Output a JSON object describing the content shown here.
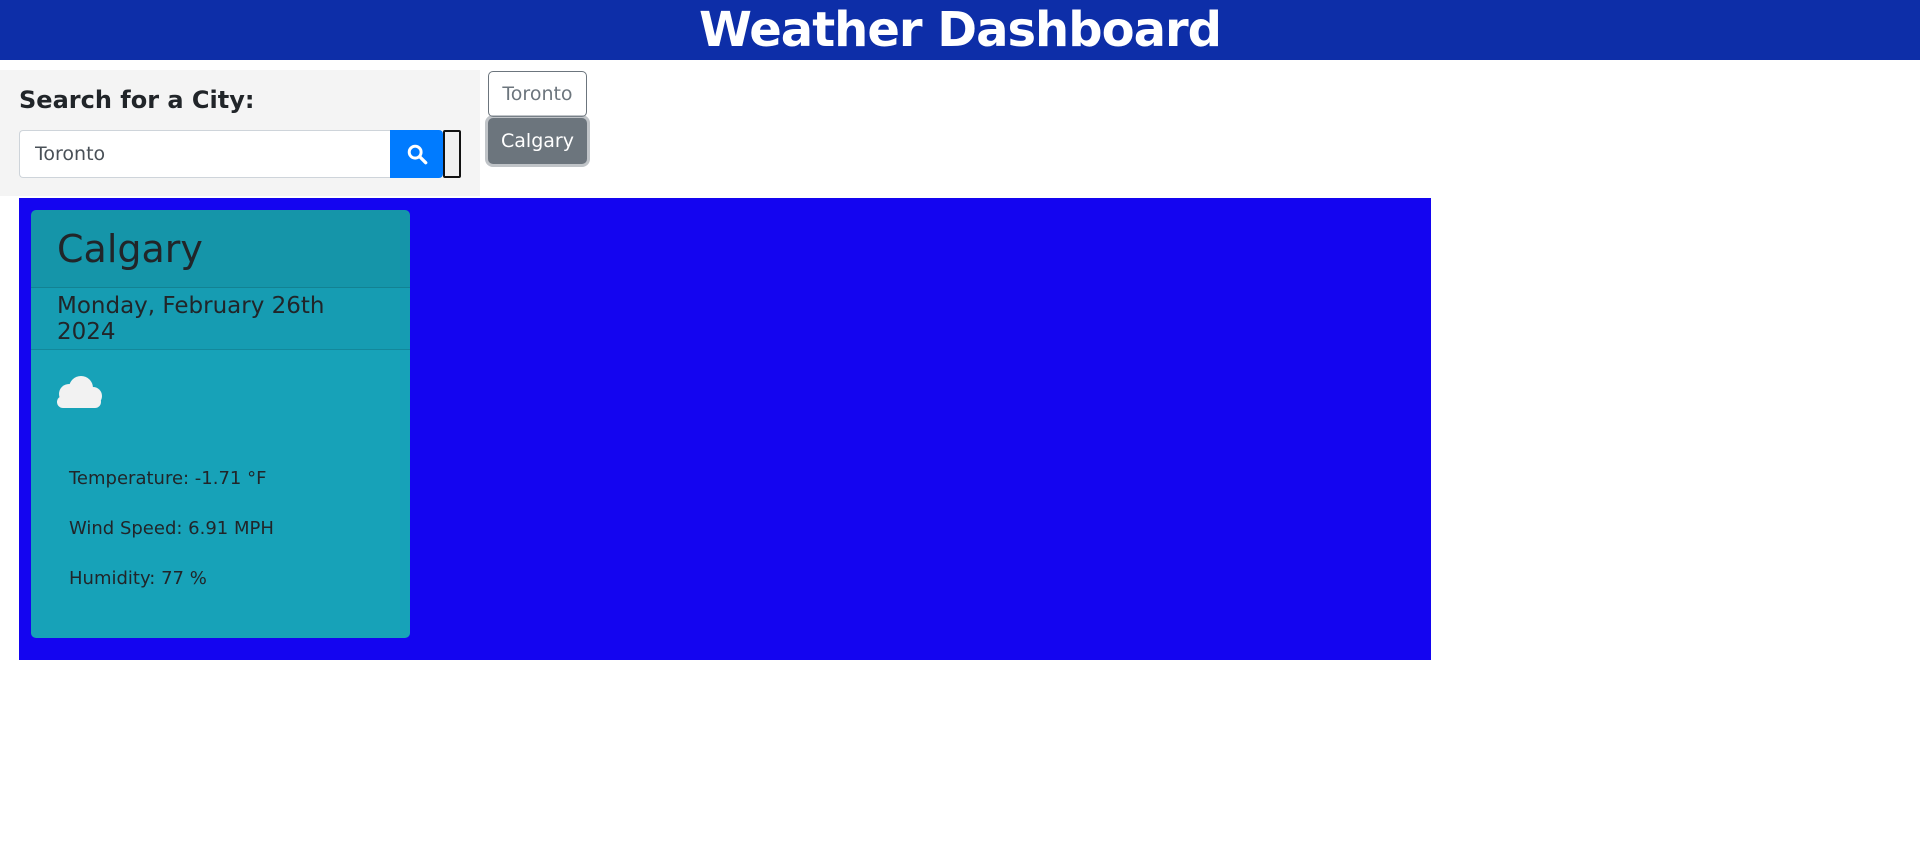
{
  "header": {
    "title": "Weather Dashboard"
  },
  "search": {
    "heading": "Search for a City:",
    "input_value": "Toronto",
    "button_icon": "search-icon"
  },
  "history": [
    {
      "label": "Toronto",
      "active": false
    },
    {
      "label": "Calgary",
      "active": true
    }
  ],
  "weather": {
    "city": "Calgary",
    "date": "Monday, February 26th 2024",
    "icon": "cloud-icon",
    "temperature": "Temperature: -1.71 °F",
    "wind": "Wind Speed: 6.91 MPH",
    "humidity": "Humidity: 77 %"
  },
  "colors": {
    "header_bg": "#0d2ea8",
    "forecast_bg": "#1405f0",
    "card_bg": "#17a2b8",
    "search_button": "#007bff",
    "history_active": "#6c757d"
  }
}
